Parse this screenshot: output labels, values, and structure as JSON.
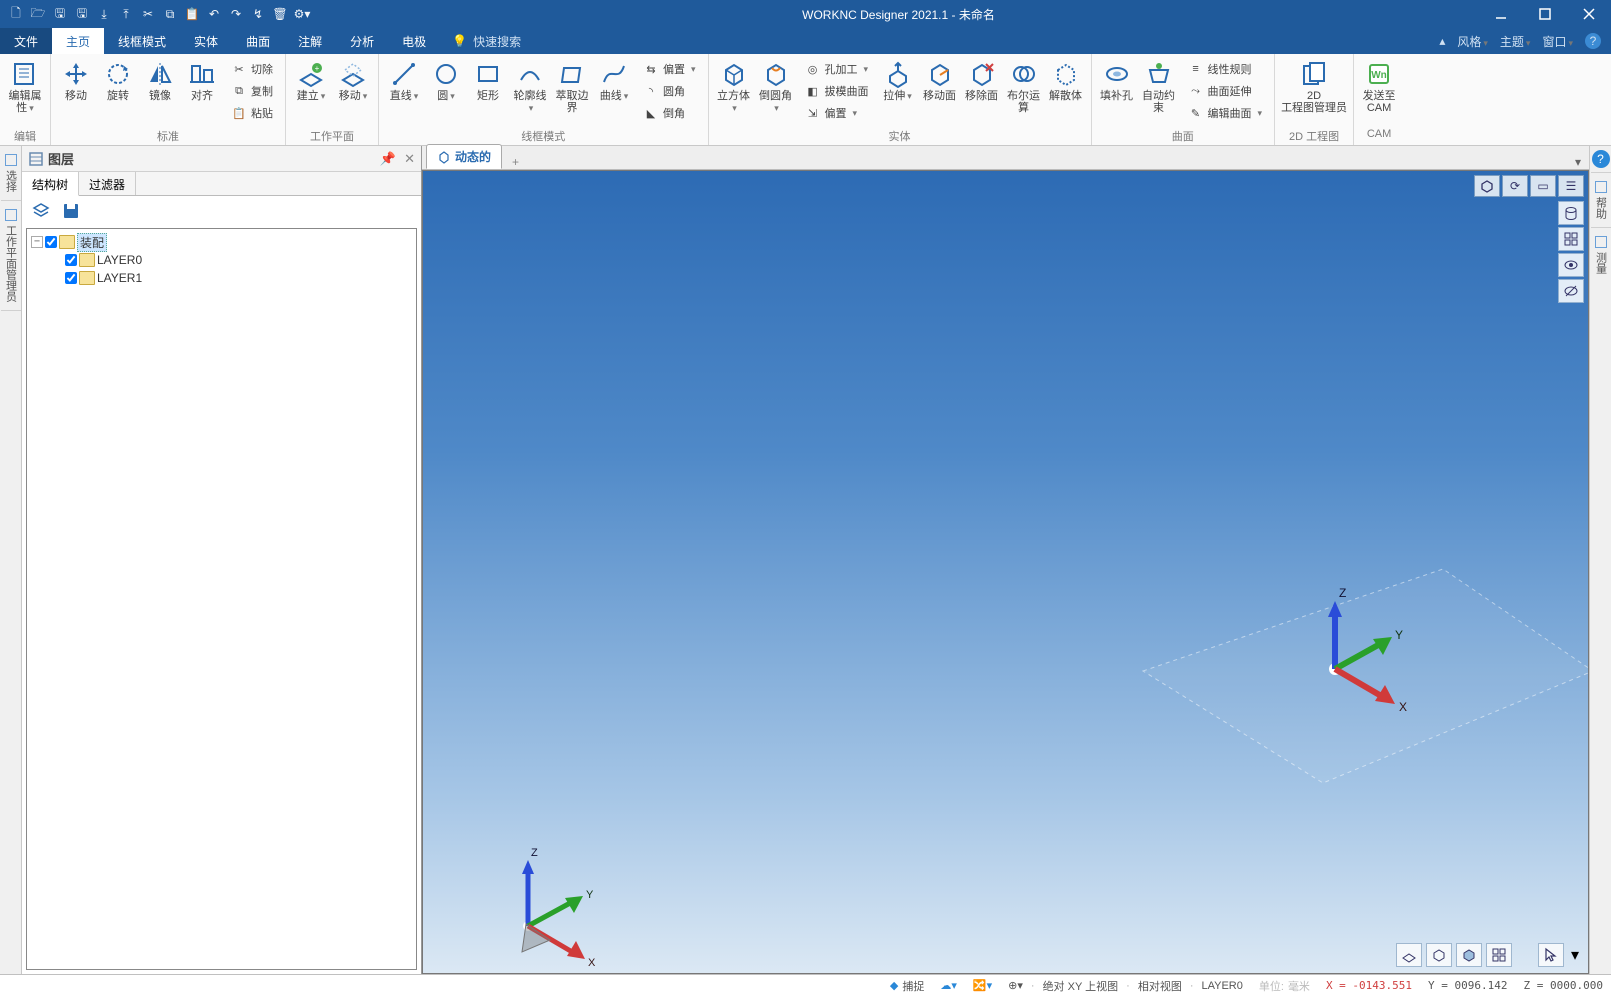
{
  "app_title": "WORKNC Designer 2021.1 - 未命名",
  "qat_icons": [
    "new",
    "open",
    "save",
    "save-all",
    "export",
    "import",
    "cut",
    "copy",
    "paste",
    "undo",
    "redo",
    "undo-list",
    "delete",
    "properties"
  ],
  "menu": {
    "file": "文件",
    "tabs": [
      "主页",
      "线框模式",
      "实体",
      "曲面",
      "注解",
      "分析",
      "电极"
    ],
    "active": "主页",
    "search_placeholder": "快速搜索",
    "right": {
      "style": "风格",
      "theme": "主题",
      "window": "窗口"
    }
  },
  "ribbon": {
    "groups": {
      "edit": {
        "label": "编辑",
        "edit_attr": "编辑属性"
      },
      "standard": {
        "label": "标准",
        "move": "移动",
        "rotate": "旋转",
        "mirror": "镜像",
        "align": "对齐",
        "cut": "切除",
        "copy": "复制",
        "paste": "粘贴"
      },
      "workplane": {
        "label": "工作平面",
        "create": "建立",
        "move": "移动"
      },
      "wireframe": {
        "label": "线框模式",
        "line": "直线",
        "circle": "圆",
        "rect": "矩形",
        "contour": "轮廓线",
        "cap": "萃取边界",
        "curve": "曲线",
        "chamfer": "偏置",
        "round": "圆角",
        "fillet": "倒角"
      },
      "solids": {
        "label": "实体",
        "cube": "立方体",
        "round": "倒圆角",
        "hole": "孔加工",
        "draft": "拔模曲面",
        "offset": "偏置",
        "extrude": "拉伸",
        "moveface": "移动面",
        "remface": "移除面",
        "boolean": "布尔运算",
        "disassemble": "解散体"
      },
      "surface": {
        "label": "曲面",
        "fill": "填补孔",
        "autoconstrain": "自动约束",
        "rule": "线性规则",
        "extend": "曲面延伸",
        "editface": "编辑曲面"
      },
      "drawing": {
        "label": "2D 工程图",
        "btn1": "2D",
        "btn2": "工程图管理员"
      },
      "cam": {
        "label": "CAM",
        "send": "发送至",
        "camlbl": "CAM"
      }
    }
  },
  "sidetabs": {
    "select": "选择",
    "wpmgr": "工作平面管理员"
  },
  "panel": {
    "title": "图层",
    "tabs": [
      "结构树",
      "过滤器"
    ],
    "active": "结构树",
    "root": "装配",
    "layers": [
      "LAYER0",
      "LAYER1"
    ]
  },
  "doc_tab": {
    "name": "动态的"
  },
  "right_panes": [
    "帮助",
    "测量"
  ],
  "status": {
    "snap": "捕捉",
    "abs": "绝对 XY 上视图",
    "rel": "相对视图",
    "layer": "LAYER0",
    "unit_lbl": "单位:",
    "unit": "毫米",
    "x": "X = -0143.551",
    "y": "Y = 0096.142",
    "z": "Z = 0000.000"
  },
  "axes": {
    "x": "X",
    "y": "Y",
    "z": "Z"
  }
}
